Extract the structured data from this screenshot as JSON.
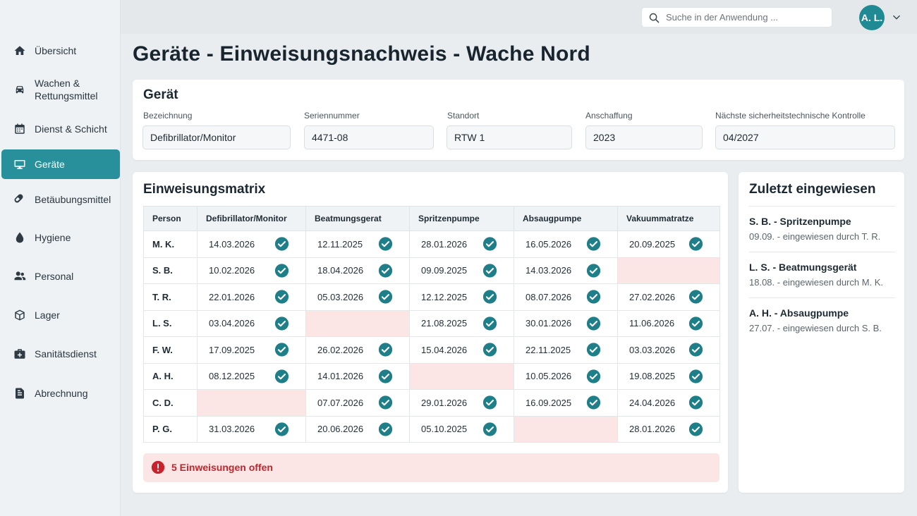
{
  "sidebar": {
    "items": [
      {
        "label": "Übersicht",
        "icon": "home-icon"
      },
      {
        "label": "Wachen &\nRettungsmittel",
        "icon": "ambulance-icon"
      },
      {
        "label": "Dienst & Schicht",
        "icon": "calendar-icon"
      },
      {
        "label": "Geräte",
        "icon": "monitor-icon",
        "active": true
      },
      {
        "label": "Betäubungsmittel",
        "icon": "pill-icon"
      },
      {
        "label": "Hygiene",
        "icon": "drop-icon"
      },
      {
        "label": "Personal",
        "icon": "people-icon"
      },
      {
        "label": "Lager",
        "icon": "box-icon"
      },
      {
        "label": "Sanitätsdienst",
        "icon": "medical-kit-icon"
      },
      {
        "label": "Abrechnung",
        "icon": "document-icon"
      }
    ]
  },
  "topbar": {
    "search_placeholder": "Suche in der Anwendung ...",
    "avatar_initials": "A. L."
  },
  "page": {
    "title": "Geräte - Einweisungsnachweis - Wache Nord"
  },
  "device": {
    "title": "Gerät",
    "fields": [
      {
        "label": "Bezeichnung",
        "value": "Defibrillator/Monitor"
      },
      {
        "label": "Seriennummer",
        "value": "4471-08"
      },
      {
        "label": "Standort",
        "value": "RTW 1"
      },
      {
        "label": "Anschaffung",
        "value": "2023"
      },
      {
        "label": "Nächste sicherheitstechnische Kontrolle",
        "value": "04/2027"
      }
    ]
  },
  "matrix": {
    "title": "Einweisungsmatrix",
    "columns": [
      "Person",
      "Defibrillator/Monitor",
      "Beatmungsgerat",
      "Spritzenpumpe",
      "Absaugpumpe",
      "Vakuummatratze"
    ],
    "rows": [
      {
        "person": "M. K.",
        "cells": [
          "14.03.2026",
          "12.11.2025",
          "28.01.2026",
          "16.05.2026",
          "20.09.2025"
        ]
      },
      {
        "person": "S. B.",
        "cells": [
          "10.02.2026",
          "18.04.2026",
          "09.09.2025",
          "14.03.2026",
          ""
        ]
      },
      {
        "person": "T. R.",
        "cells": [
          "22.01.2026",
          "05.03.2026",
          "12.12.2025",
          "08.07.2026",
          "27.02.2026"
        ]
      },
      {
        "person": "L. S.",
        "cells": [
          "03.04.2026",
          "",
          "21.08.2025",
          "30.01.2026",
          "11.06.2026"
        ]
      },
      {
        "person": "F. W.",
        "cells": [
          "17.09.2025",
          "26.02.2026",
          "15.04.2026",
          "22.11.2025",
          "03.03.2026"
        ]
      },
      {
        "person": "A. H.",
        "cells": [
          "08.12.2025",
          "14.01.2026",
          "",
          "10.05.2026",
          "19.08.2025"
        ]
      },
      {
        "person": "C. D.",
        "cells": [
          "",
          "07.07.2026",
          "29.01.2026",
          "16.09.2025",
          "24.04.2026"
        ]
      },
      {
        "person": "P. G.",
        "cells": [
          "31.03.2026",
          "20.06.2026",
          "05.10.2025",
          "",
          "28.01.2026"
        ]
      }
    ],
    "alert": "5 Einweisungen offen"
  },
  "recent": {
    "title": "Zuletzt eingewiesen",
    "items": [
      {
        "title": "S. B. - Spritzenpumpe",
        "subtitle": "09.09. - eingewiesen durch T. R."
      },
      {
        "title": "L. S. - Beatmungsgerät",
        "subtitle": "18.08. - eingewiesen durch M. K."
      },
      {
        "title": "A. H. - Absaugpumpe",
        "subtitle": "27.07. - eingewiesen durch S. B."
      }
    ]
  },
  "colors": {
    "accent": "#28909a",
    "check": "#1f7f88",
    "missing": "#fbe5e5",
    "alert_text": "#c0262d"
  }
}
